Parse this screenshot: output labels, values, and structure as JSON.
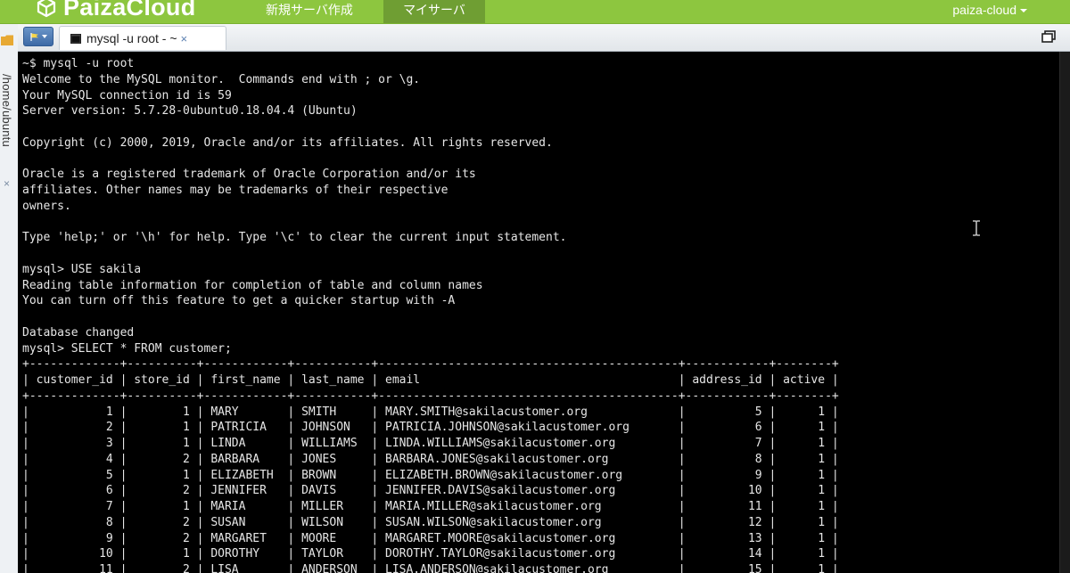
{
  "header": {
    "brand": "PaizaCloud",
    "nav": {
      "new_server": "新規サーバ作成",
      "my_servers": "マイサーバ"
    },
    "user": "paiza-cloud"
  },
  "sidebar": {
    "vertical_tab_label": "/home/ubuntu",
    "close_glyph": "×"
  },
  "tabs": [
    {
      "label": "mysql -u root - ~",
      "close_glyph": "×",
      "active": true
    }
  ],
  "terminal": {
    "lines": [
      "~$ mysql -u root",
      "Welcome to the MySQL monitor.  Commands end with ; or \\g.",
      "Your MySQL connection id is 59",
      "Server version: 5.7.28-0ubuntu0.18.04.4 (Ubuntu)",
      "",
      "Copyright (c) 2000, 2019, Oracle and/or its affiliates. All rights reserved.",
      "",
      "Oracle is a registered trademark of Oracle Corporation and/or its",
      "affiliates. Other names may be trademarks of their respective",
      "owners.",
      "",
      "Type 'help;' or '\\h' for help. Type '\\c' to clear the current input statement.",
      "",
      "mysql> USE sakila",
      "Reading table information for completion of table and column names",
      "You can turn off this feature to get a quicker startup with -A",
      "",
      "Database changed",
      "mysql> SELECT * FROM customer;",
      "+-------------+----------+------------+-----------+-------------------------------------------+------------+--------+",
      "| customer_id | store_id | first_name | last_name | email                                     | address_id | active |",
      "+-------------+----------+------------+-----------+-------------------------------------------+------------+--------+",
      "|           1 |        1 | MARY       | SMITH     | MARY.SMITH@sakilacustomer.org             |          5 |      1 |",
      "|           2 |        1 | PATRICIA   | JOHNSON   | PATRICIA.JOHNSON@sakilacustomer.org       |          6 |      1 |",
      "|           3 |        1 | LINDA      | WILLIAMS  | LINDA.WILLIAMS@sakilacustomer.org         |          7 |      1 |",
      "|           4 |        2 | BARBARA    | JONES     | BARBARA.JONES@sakilacustomer.org          |          8 |      1 |",
      "|           5 |        1 | ELIZABETH  | BROWN     | ELIZABETH.BROWN@sakilacustomer.org        |          9 |      1 |",
      "|           6 |        2 | JENNIFER   | DAVIS     | JENNIFER.DAVIS@sakilacustomer.org         |         10 |      1 |",
      "|           7 |        1 | MARIA      | MILLER    | MARIA.MILLER@sakilacustomer.org           |         11 |      1 |",
      "|           8 |        2 | SUSAN      | WILSON    | SUSAN.WILSON@sakilacustomer.org           |         12 |      1 |",
      "|           9 |        2 | MARGARET   | MOORE     | MARGARET.MOORE@sakilacustomer.org         |         13 |      1 |",
      "|          10 |        1 | DOROTHY    | TAYLOR    | DOROTHY.TAYLOR@sakilacustomer.org         |         14 |      1 |",
      "|          11 |        2 | LISA       | ANDERSON  | LISA.ANDERSON@sakilacustomer.org          |         15 |      1 |"
    ]
  },
  "colors": {
    "brand_green": "#8dc63f",
    "active_nav": "#6f9e33",
    "terminal_bg": "#000000",
    "terminal_fg": "#e6e6e6"
  },
  "icons": {
    "logo": "cube-logo-icon",
    "menu": "flag-menu-icon",
    "tab": "terminal-icon",
    "restore": "window-restore-icon",
    "folder": "folder-icon",
    "cursor": "text-cursor-icon"
  }
}
